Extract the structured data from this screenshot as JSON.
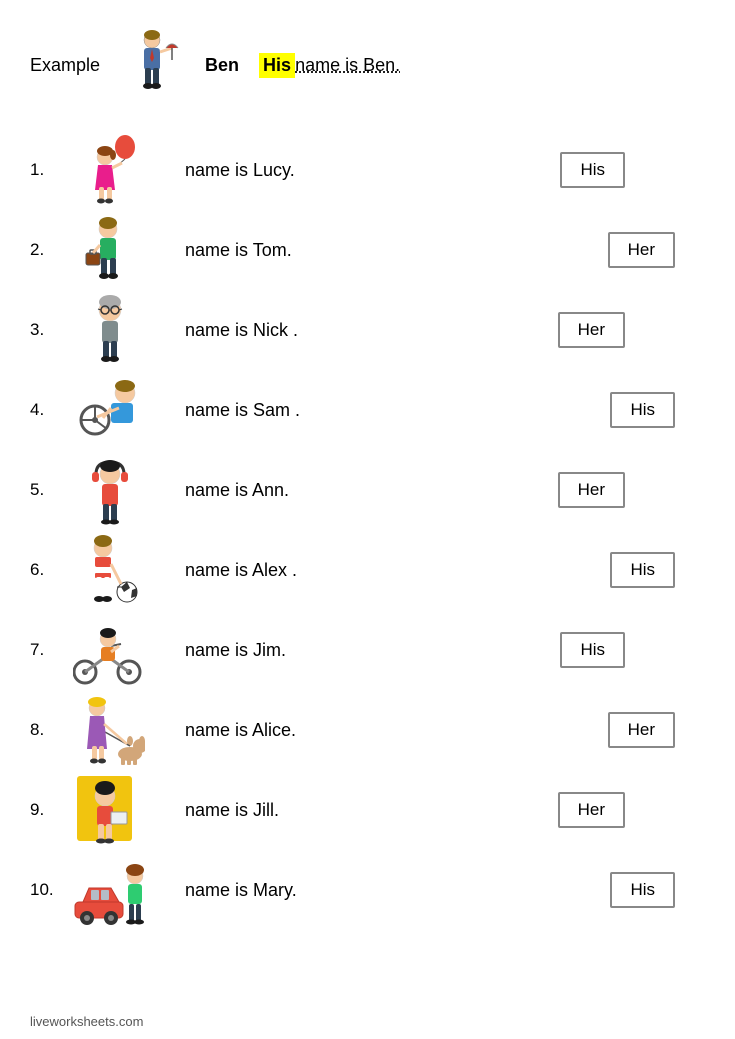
{
  "example": {
    "label": "Example",
    "name": "Ben",
    "pronoun": "His",
    "sentence": "name is Ben."
  },
  "items": [
    {
      "number": "1.",
      "sentence": "name is Lucy.",
      "pronoun": "His",
      "gender": "girl"
    },
    {
      "number": "2.",
      "sentence": "name is Tom.",
      "pronoun": "Her",
      "gender": "boy"
    },
    {
      "number": "3.",
      "sentence": "name is Nick .",
      "pronoun": "Her",
      "gender": "man"
    },
    {
      "number": "4.",
      "sentence": "name is Sam .",
      "pronoun": "His",
      "gender": "teen-boy"
    },
    {
      "number": "5.",
      "sentence": "name is Ann.",
      "pronoun": "Her",
      "gender": "girl2"
    },
    {
      "number": "6.",
      "sentence": "name is Alex .",
      "pronoun": "His",
      "gender": "boy2"
    },
    {
      "number": "7.",
      "sentence": "name is Jim.",
      "pronoun": "His",
      "gender": "biker"
    },
    {
      "number": "8.",
      "sentence": "name is Alice.",
      "pronoun": "Her",
      "gender": "girl3"
    },
    {
      "number": "9.",
      "sentence": "name is Jill.",
      "pronoun": "Her",
      "gender": "girl4"
    },
    {
      "number": "10.",
      "sentence": "name is Mary.",
      "pronoun": "His",
      "gender": "woman"
    }
  ],
  "footer": "liveworksheets.com"
}
